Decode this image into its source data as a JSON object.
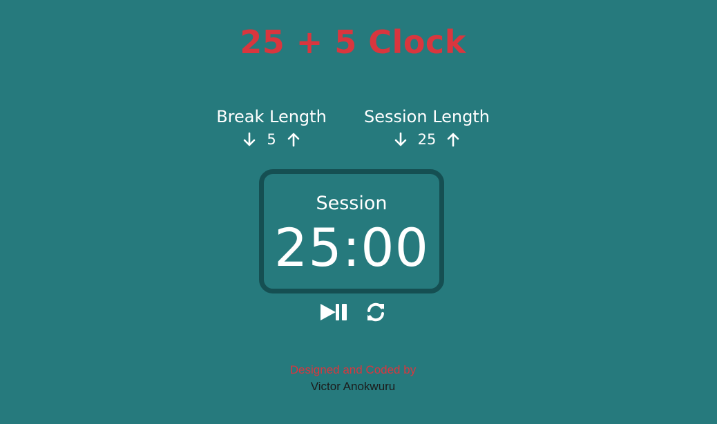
{
  "app": {
    "title": "25 + 5 Clock"
  },
  "break": {
    "label": "Break Length",
    "value": "5",
    "decrement_icon": "arrow-down-icon",
    "increment_icon": "arrow-up-icon"
  },
  "session": {
    "label": "Session Length",
    "value": "25",
    "decrement_icon": "arrow-down-icon",
    "increment_icon": "arrow-up-icon"
  },
  "timer": {
    "label": "Session",
    "time": "25:00"
  },
  "player": {
    "play_pause_icon": "play-pause-icon",
    "reset_icon": "refresh-icon"
  },
  "footer": {
    "credit": "Designed and Coded by",
    "author": "Victor Anokwuru"
  },
  "colors": {
    "background": "#267a7d",
    "accent": "#d9363e",
    "timer_border": "#154f52",
    "text": "#ffffff"
  }
}
